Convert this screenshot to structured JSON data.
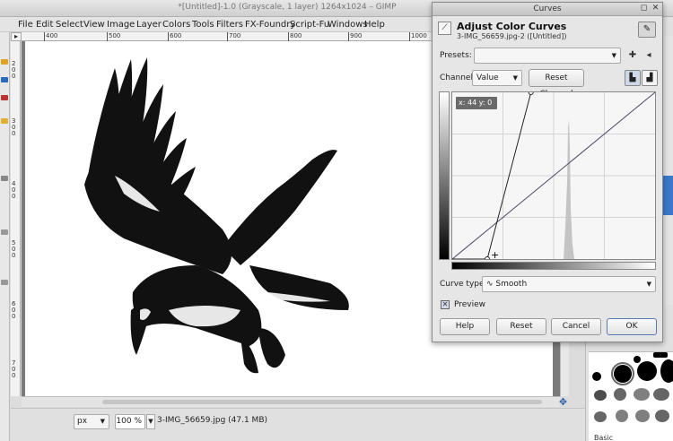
{
  "window": {
    "title": "*[Untitled]-1.0 (Grayscale, 1 layer) 1264x1024 – GIMP"
  },
  "menu": [
    "File",
    "Edit",
    "Select",
    "View",
    "Image",
    "Layer",
    "Colors",
    "Tools",
    "Filters",
    "FX-Foundry",
    "Script-Fu",
    "Windows",
    "Help"
  ],
  "ruler_h": [
    "400",
    "500",
    "600",
    "700",
    "800",
    "900",
    "1000"
  ],
  "ruler_v": [
    "2\n0\n0",
    "3\n0\n0",
    "4\n0\n0",
    "5\n0\n0",
    "6\n0\n0",
    "7\n0\n0"
  ],
  "statusbar": {
    "unit": "px",
    "zoom": "100 %",
    "info": "3-IMG_56659.jpg (47.1 MB)"
  },
  "curves_dialog": {
    "title": "Curves",
    "heading": "Adjust Color Curves",
    "subheading": "3-IMG_56659.jpg-2 ([Untitled])",
    "presets_label": "Presets:",
    "presets_value": "",
    "channel_label": "Channel:",
    "channel_value": "Value",
    "reset_channel_label": "Reset Channel",
    "coord_readout": "x: 44 y:   0",
    "curve_type_label": "Curve type:",
    "curve_type_value": "Smooth",
    "preview_label": "Preview",
    "preview_checked": true,
    "help_label": "Help",
    "reset_label": "Reset",
    "cancel_label": "Cancel",
    "ok_label": "OK",
    "curve_points": [
      [
        44,
        0
      ],
      [
        99,
        255
      ]
    ]
  },
  "brushes": {
    "label": "Basic"
  },
  "colors": {
    "accent": "#3a78c8",
    "dialog_bg": "#e6e6e6",
    "graph_bg": "#f6f6f6",
    "curve_line": "#333355"
  },
  "icons": {
    "close": "close-icon",
    "color_picker": "eyedropper-icon",
    "add_preset": "plus-icon",
    "manage_preset": "menu-icon",
    "navigate": "move-icon"
  }
}
